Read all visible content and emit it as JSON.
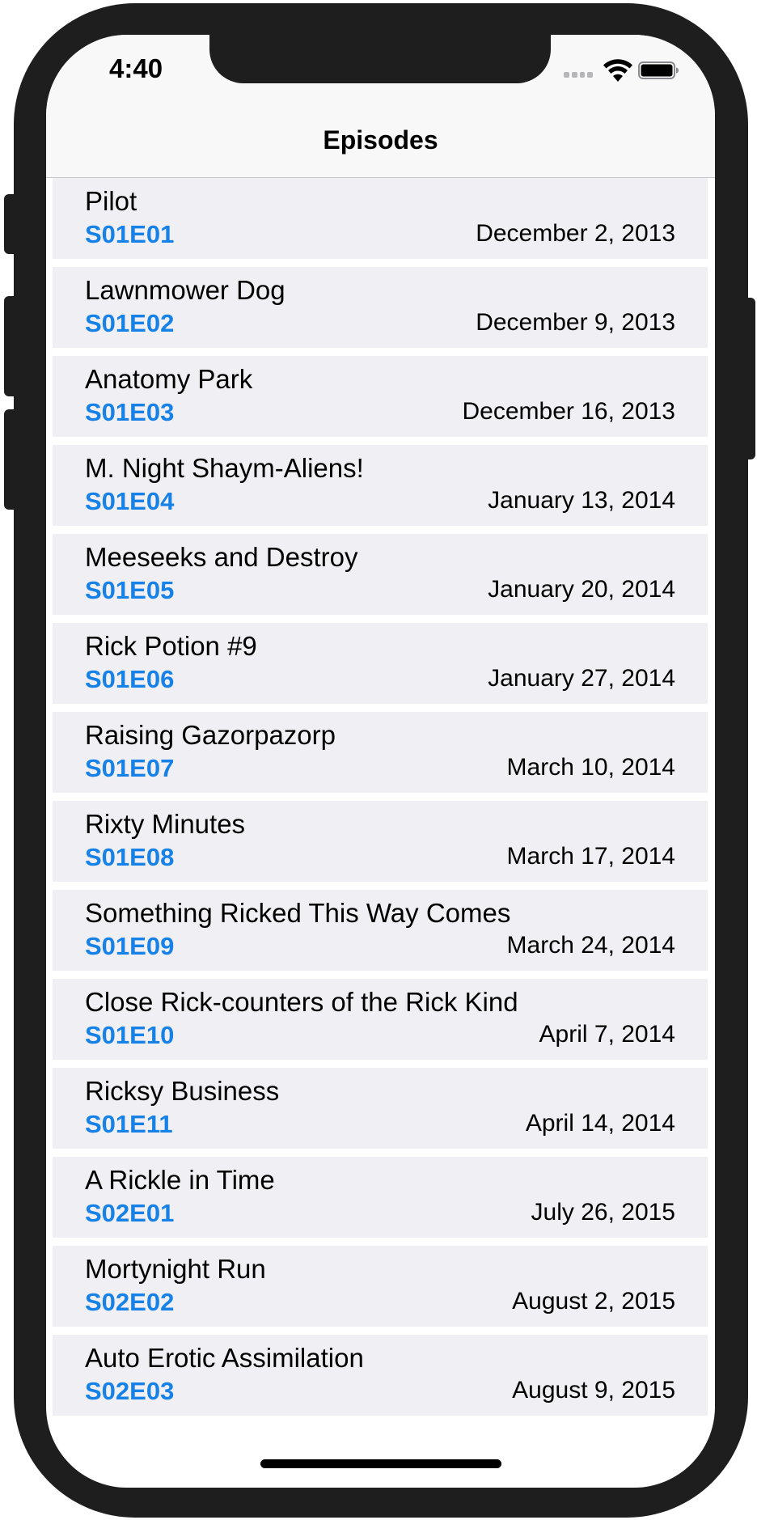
{
  "status_bar": {
    "time": "4:40"
  },
  "nav": {
    "title": "Episodes"
  },
  "episodes": [
    {
      "title": "Pilot",
      "code": "S01E01",
      "date": "December 2, 2013"
    },
    {
      "title": "Lawnmower Dog",
      "code": "S01E02",
      "date": "December 9, 2013"
    },
    {
      "title": "Anatomy Park",
      "code": "S01E03",
      "date": "December 16, 2013"
    },
    {
      "title": "M. Night Shaym-Aliens!",
      "code": "S01E04",
      "date": "January 13, 2014"
    },
    {
      "title": "Meeseeks and Destroy",
      "code": "S01E05",
      "date": "January 20, 2014"
    },
    {
      "title": "Rick Potion #9",
      "code": "S01E06",
      "date": "January 27, 2014"
    },
    {
      "title": "Raising Gazorpazorp",
      "code": "S01E07",
      "date": "March 10, 2014"
    },
    {
      "title": "Rixty Minutes",
      "code": "S01E08",
      "date": "March 17, 2014"
    },
    {
      "title": "Something Ricked This Way Comes",
      "code": "S01E09",
      "date": "March 24, 2014"
    },
    {
      "title": "Close Rick-counters of the Rick Kind",
      "code": "S01E10",
      "date": "April 7, 2014"
    },
    {
      "title": "Ricksy Business",
      "code": "S01E11",
      "date": "April 14, 2014"
    },
    {
      "title": "A Rickle in Time",
      "code": "S02E01",
      "date": "July 26, 2015"
    },
    {
      "title": "Mortynight Run",
      "code": "S02E02",
      "date": "August 2, 2015"
    },
    {
      "title": "Auto Erotic Assimilation",
      "code": "S02E03",
      "date": "August 9, 2015"
    }
  ],
  "colors": {
    "accent": "#1681e6",
    "row_background": "#efeff4",
    "navbar_background": "#f8f8f8"
  }
}
